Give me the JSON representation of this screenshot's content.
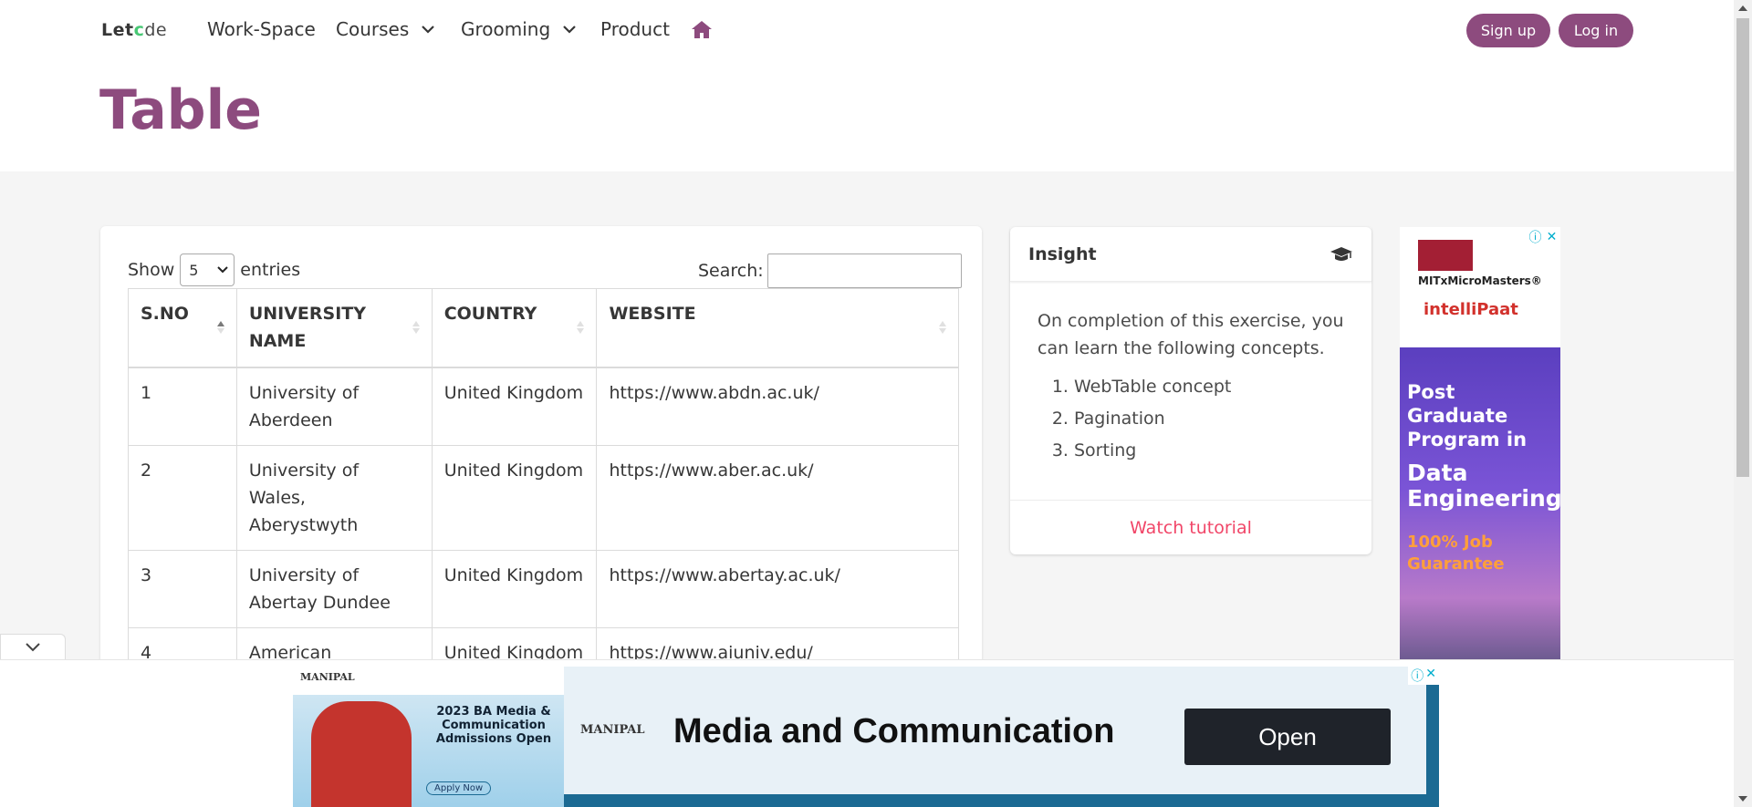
{
  "nav": {
    "logo_prefix": "Let",
    "logo_o": "c",
    "logo_suffix": "de",
    "items": [
      {
        "label": "Work-Space"
      },
      {
        "label": "Courses"
      },
      {
        "label": "Grooming"
      },
      {
        "label": "Product"
      }
    ],
    "signup": "Sign up",
    "login": "Log in",
    "accent": "#8d4b7e"
  },
  "page": {
    "title": "Table"
  },
  "table_controls": {
    "show_label": "Show",
    "entries_value": "5",
    "entries_label": "entries",
    "search_label": "Search:",
    "search_value": ""
  },
  "table": {
    "headers": [
      "S.NO",
      "UNIVERSITY NAME",
      "COUNTRY",
      "WEBSITE"
    ],
    "rows": [
      [
        "1",
        "University of Aberdeen",
        "United Kingdom",
        "https://www.abdn.ac.uk/"
      ],
      [
        "2",
        "University of Wales, Aberystwyth",
        "United Kingdom",
        "https://www.aber.ac.uk/"
      ],
      [
        "3",
        "University of Abertay Dundee",
        "United Kingdom",
        "https://www.abertay.ac.uk/"
      ],
      [
        "4",
        "American InterContinental",
        "United Kingdom",
        "https://www.aiuniv.edu/"
      ]
    ]
  },
  "insight": {
    "title": "Insight",
    "intro": "On completion of this exercise, you can learn the following concepts.",
    "items": [
      "WebTable concept",
      "Pagination",
      "Sorting"
    ],
    "footer": "Watch tutorial"
  },
  "side_ad": {
    "brand1": "MITxMicroMasters®",
    "brand2": "intelliPaat",
    "line1": "Post Graduate Program in",
    "line2": "Data Engineering",
    "line3": "100% Job Guarantee"
  },
  "bottom_ad": {
    "left_brand": "MANIPAL",
    "left_text": "2023 BA Media & Communication Admissions Open",
    "apply": "Apply Now",
    "brand": "MANIPAL",
    "title": "Media and Communication",
    "cta": "Open"
  }
}
